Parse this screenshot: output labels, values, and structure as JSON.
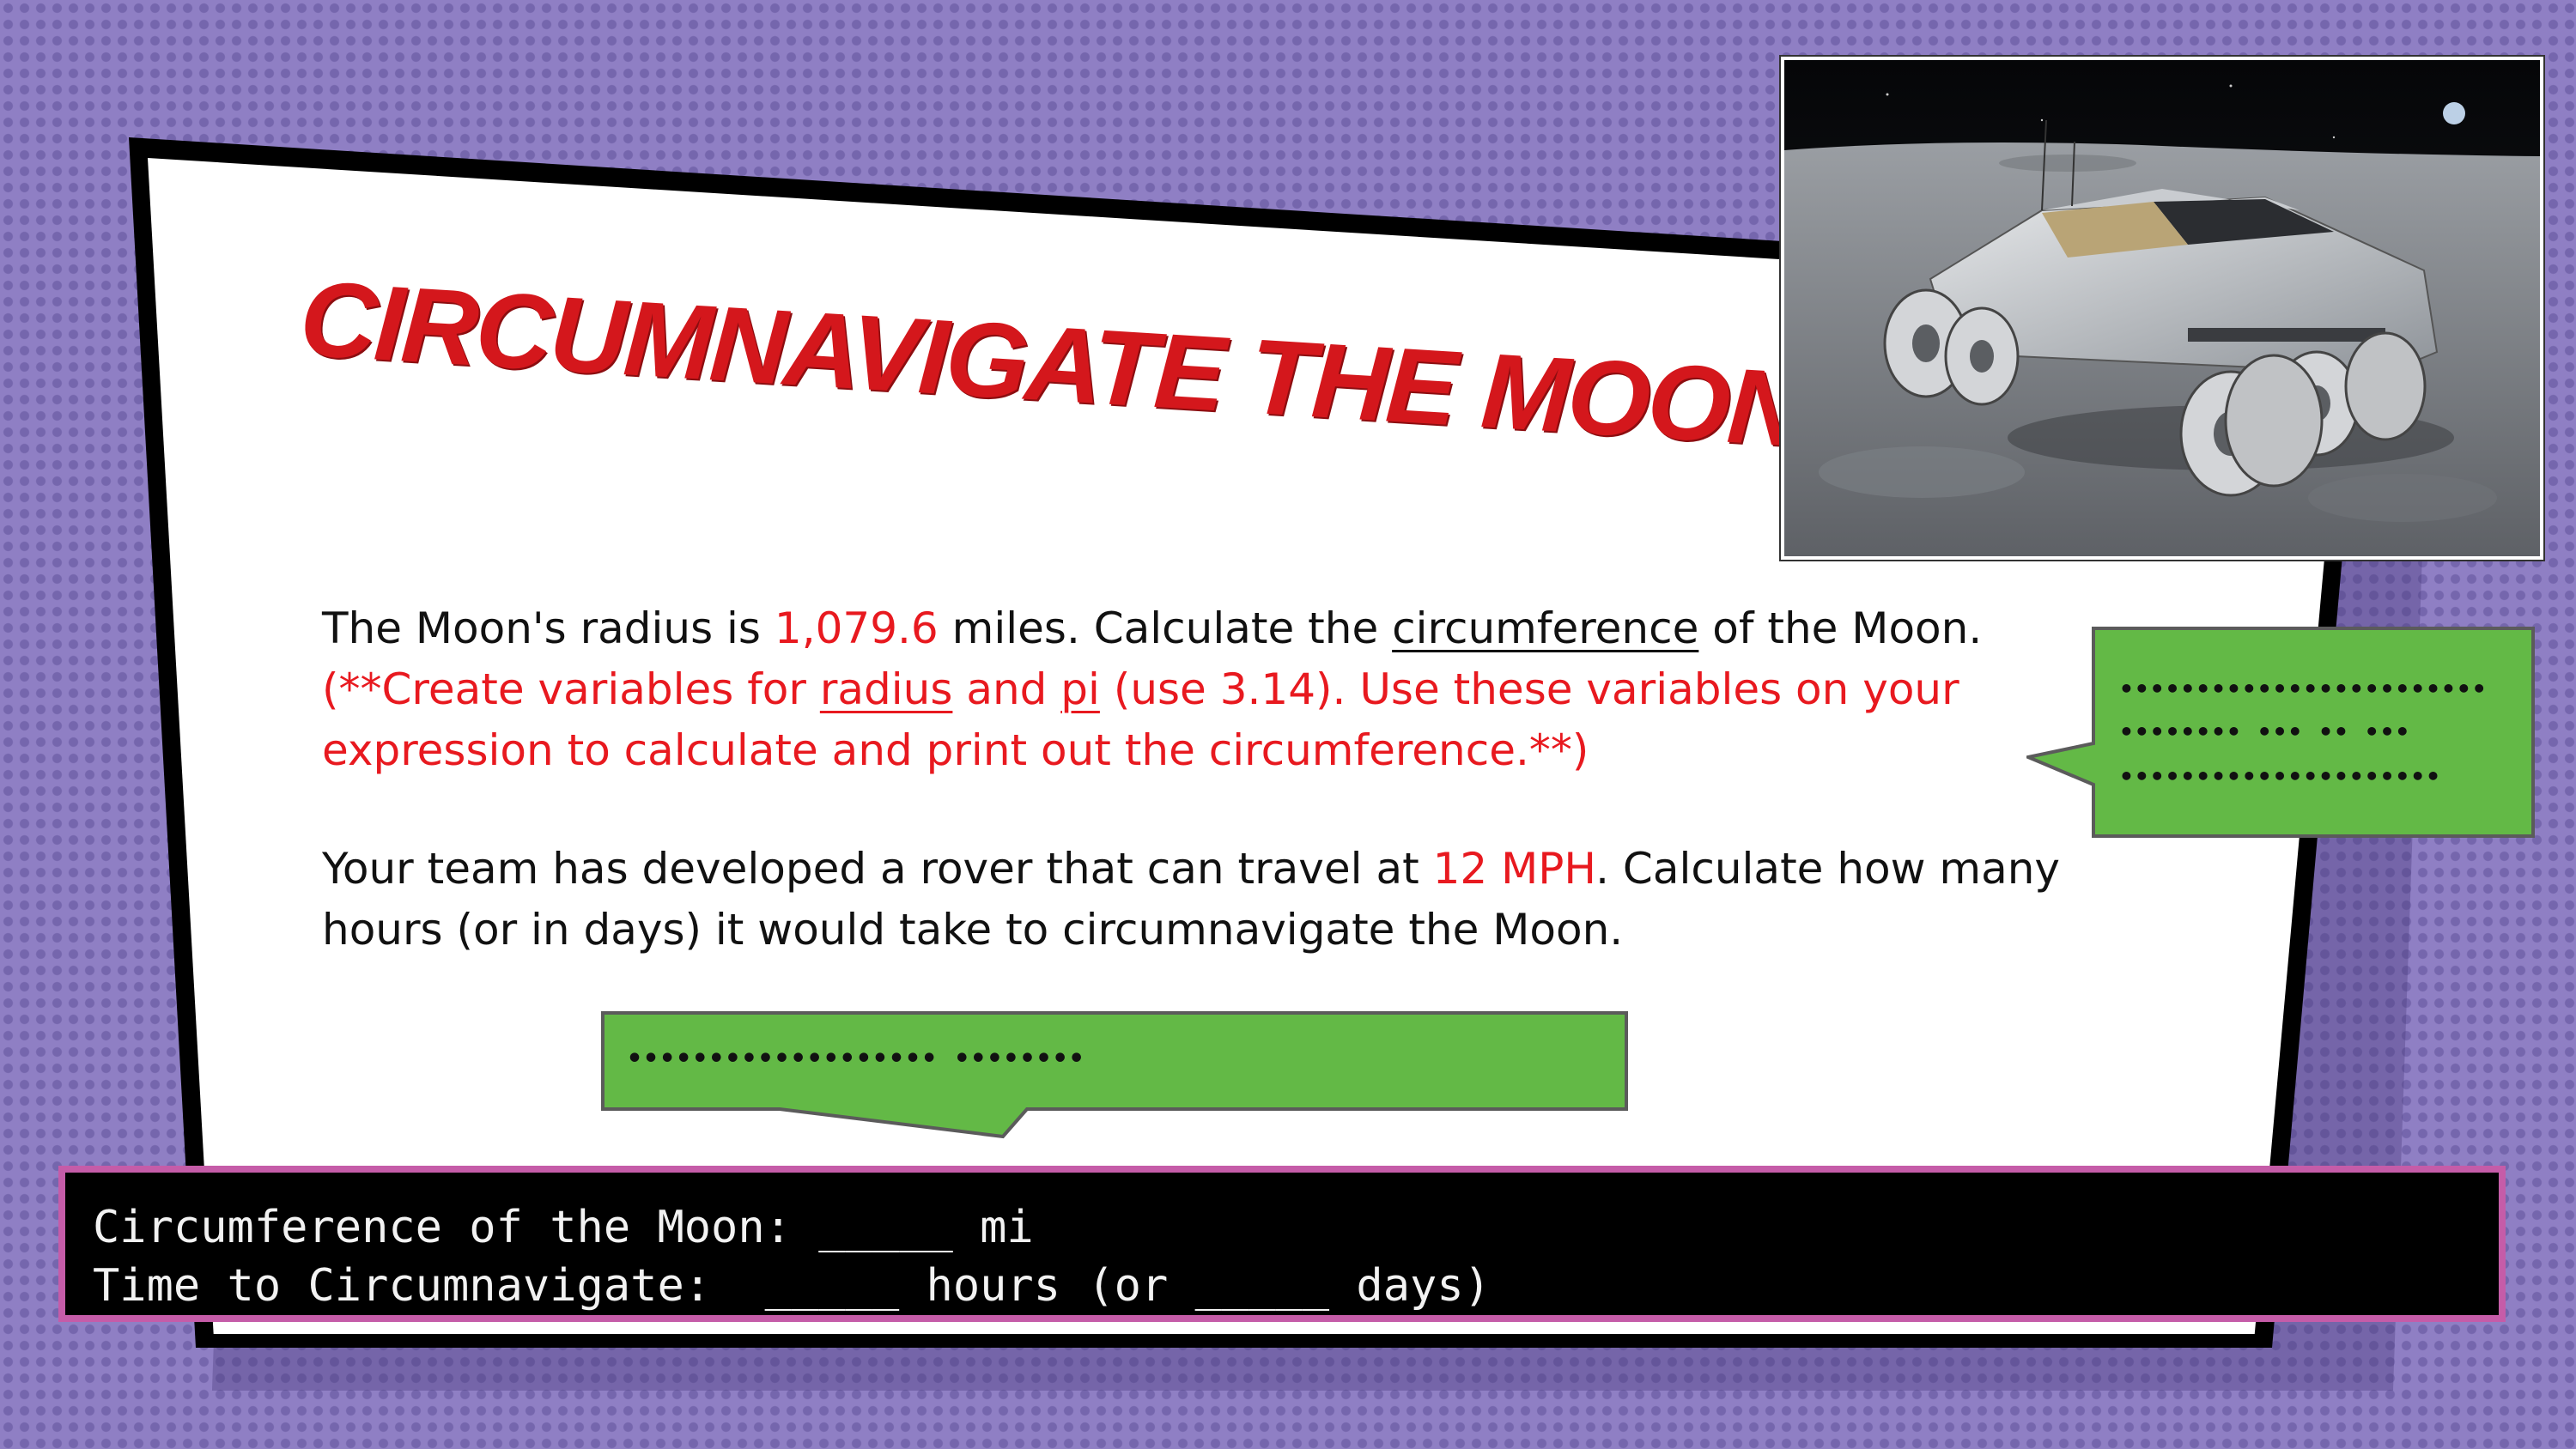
{
  "title": "Circumnavigate the Moon",
  "problem1": {
    "line1_a": "The Moon's radius is ",
    "radius_value": "1,079.6",
    "line1_b": " miles. Calculate the ",
    "circumference_word": "circumference",
    "line1_c": " of the Moon.",
    "line2_a": "(**Create variables for ",
    "radius_word": "radius",
    "line2_b": " and ",
    "pi_word": "pi",
    "line2_c": " (use 3.14). Use these variables on your",
    "line3": "expression to calculate and print out the circumference.**)"
  },
  "problem2": {
    "line1_a": "Your team has developed a rover that can travel at ",
    "speed_value": "12 MPH",
    "line1_b": ". Calculate how many",
    "line2": "hours (or in days) it would take to circumnavigate the Moon."
  },
  "hint_bubble_right": {
    "line1": "••••••••••••••••••••••••",
    "line2": "•••••••• ••• •• •••",
    "line3": "•••••••••••••••••••••"
  },
  "hint_bubble_bottom": {
    "text": "••••••••••••••••••• ••••••••"
  },
  "terminal": {
    "line1": "Circumference of the Moon: _____ mi",
    "line2": "Time to Circumnavigate:  _____ hours (or _____ days)"
  },
  "photo": {
    "subject": "lunar-rover-photo"
  },
  "colors": {
    "background": "#8f7fc4",
    "title_red": "#d4171c",
    "highlight_red": "#e8191f",
    "bubble_green": "#63b946",
    "terminal_border": "#c55ca8",
    "terminal_bg": "#000000"
  }
}
